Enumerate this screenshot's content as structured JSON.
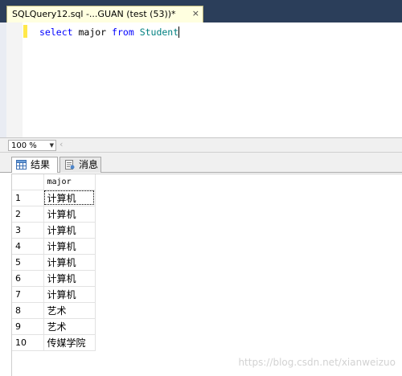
{
  "document_tab": {
    "title": "SQLQuery12.sql -...GUAN (test (53))*",
    "close_glyph": "×"
  },
  "editor": {
    "tokens": {
      "select": "select",
      "space": " ",
      "column": "major",
      "from": "from",
      "table": "Student"
    }
  },
  "zoom": {
    "value": "100 %",
    "dropdown_glyph": "▼"
  },
  "results_tabs": {
    "results_label": "结果",
    "messages_label": "消息"
  },
  "grid": {
    "column_header": "major",
    "rows": [
      {
        "num": "1",
        "major": "计算机"
      },
      {
        "num": "2",
        "major": "计算机"
      },
      {
        "num": "3",
        "major": "计算机"
      },
      {
        "num": "4",
        "major": "计算机"
      },
      {
        "num": "5",
        "major": "计算机"
      },
      {
        "num": "6",
        "major": "计算机"
      },
      {
        "num": "7",
        "major": "计算机"
      },
      {
        "num": "8",
        "major": "艺术"
      },
      {
        "num": "9",
        "major": "艺术"
      },
      {
        "num": "10",
        "major": "传媒学院"
      }
    ]
  },
  "watermark": "https://blog.csdn.net/xianweizuo",
  "colors": {
    "tabstrip_bg": "#2b3e5a",
    "active_doc_tab": "#ffffe0",
    "keyword": "#0000ff",
    "identifier": "#008080",
    "change_bar": "#ffe84a"
  },
  "icons": {
    "results_tab": "grid-icon",
    "messages_tab": "message-doc-icon",
    "scroll_left": "chevron-left-icon"
  }
}
